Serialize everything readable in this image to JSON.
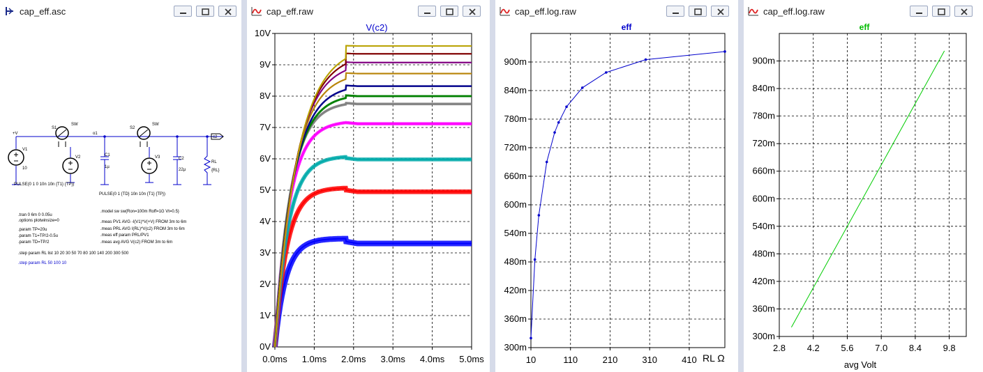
{
  "schematic": {
    "title": "cap_eff.asc",
    "labels": {
      "vplus": "+V",
      "o1": "o1",
      "c2": "c2",
      "s1": "S1",
      "s2": "S2",
      "sw1": "SW",
      "sw2": "SW",
      "v1": "V1",
      "v1_value": "10",
      "v2": "V2",
      "v3": "V3",
      "c1": "C1",
      "c1_value": "1µ",
      "c2_ref": "C2",
      "c2_value": "22µ",
      "rl": "RL",
      "rl_value": "{RL}"
    },
    "pulse_v2": "PULSE(0 1 0 10n 10n {T1} {TP})",
    "pulse_v3": "PULSE(0 1 {TD} 10n 10n {T1} {TP})",
    "directives_left": [
      ".tran 0 6m 0 0.05u",
      ".options plotwinsize=0",
      ".param TP=20u",
      ".param T1=TP/2-0.5u",
      ".param TD=TP/2"
    ],
    "directives_right": [
      ".model sw sw(Ron=100m Roff=1G Vt=0.5)",
      ".meas PV1 AVG -I(V1)*V(+V) FROM 3m to 6m",
      ".meas PRL AVG I(RL)*V(c2) FROM 3m to 6m",
      ".meas eff param PRL/PV1",
      ".meas avg AVG V(c2) FROM 3m to 6m"
    ],
    "step_list": ".step param RL list 10 20 30 50 70 80 100 140 200 300 500",
    "step_active": ".step param RL 50 100 10"
  },
  "waveform": {
    "title": "cap_eff.raw",
    "trace": "V(c2)",
    "chart_data": {
      "type": "line",
      "title": "V(c2)",
      "xlabel": "",
      "ylabel": "",
      "xlim": [
        0,
        5
      ],
      "ylim": [
        0,
        10
      ],
      "x_unit": "ms",
      "y_unit": "V",
      "x_ticks": [
        "0.0ms",
        "1.0ms",
        "2.0ms",
        "3.0ms",
        "4.0ms",
        "5.0ms"
      ],
      "y_ticks": [
        "0V",
        "1V",
        "2V",
        "3V",
        "4V",
        "5V",
        "6V",
        "7V",
        "8V",
        "9V",
        "10V"
      ],
      "series": [
        {
          "color": "#0000ff",
          "final": 3.3
        },
        {
          "color": "#ff0000",
          "final": 4.95
        },
        {
          "color": "#00aaaa",
          "final": 5.98
        },
        {
          "color": "#ff00ff",
          "final": 7.12
        },
        {
          "color": "#808080",
          "final": 7.75
        },
        {
          "color": "#008000",
          "final": 8.0
        },
        {
          "color": "#00008b",
          "final": 8.32
        },
        {
          "color": "#b8860b",
          "final": 8.72
        },
        {
          "color": "#800080",
          "final": 9.07
        },
        {
          "color": "#800000",
          "final": 9.35
        },
        {
          "color": "#b8a200",
          "final": 9.6
        }
      ]
    }
  },
  "eff_plot": {
    "title": "cap_eff.log.raw",
    "chart_data": {
      "type": "line",
      "title": "eff",
      "xlabel": "RL Ω",
      "ylabel": "",
      "xlim": [
        10,
        500
      ],
      "ylim": [
        300,
        960
      ],
      "x_ticks": [
        "10",
        "110",
        "210",
        "310",
        "410"
      ],
      "y_ticks": [
        "300m",
        "360m",
        "420m",
        "480m",
        "540m",
        "600m",
        "660m",
        "720m",
        "780m",
        "840m",
        "900m"
      ],
      "x": [
        10,
        20,
        30,
        50,
        70,
        80,
        100,
        140,
        200,
        300,
        500
      ],
      "y": [
        320,
        485,
        578,
        690,
        752,
        773,
        806,
        846,
        878,
        905,
        922
      ]
    }
  },
  "avg_plot": {
    "title": "cap_eff.log.raw",
    "chart_data": {
      "type": "line",
      "title": "eff",
      "xlabel": "avg Volt",
      "ylabel": "",
      "xlim": [
        2.8,
        10.5
      ],
      "ylim": [
        300,
        960
      ],
      "x_ticks": [
        "2.8",
        "4.2",
        "5.6",
        "7.0",
        "8.4",
        "9.8"
      ],
      "y_ticks": [
        "300m",
        "360m",
        "420m",
        "480m",
        "540m",
        "600m",
        "660m",
        "720m",
        "780m",
        "840m",
        "900m"
      ],
      "x": [
        3.3,
        9.6
      ],
      "y": [
        320,
        922
      ]
    }
  }
}
